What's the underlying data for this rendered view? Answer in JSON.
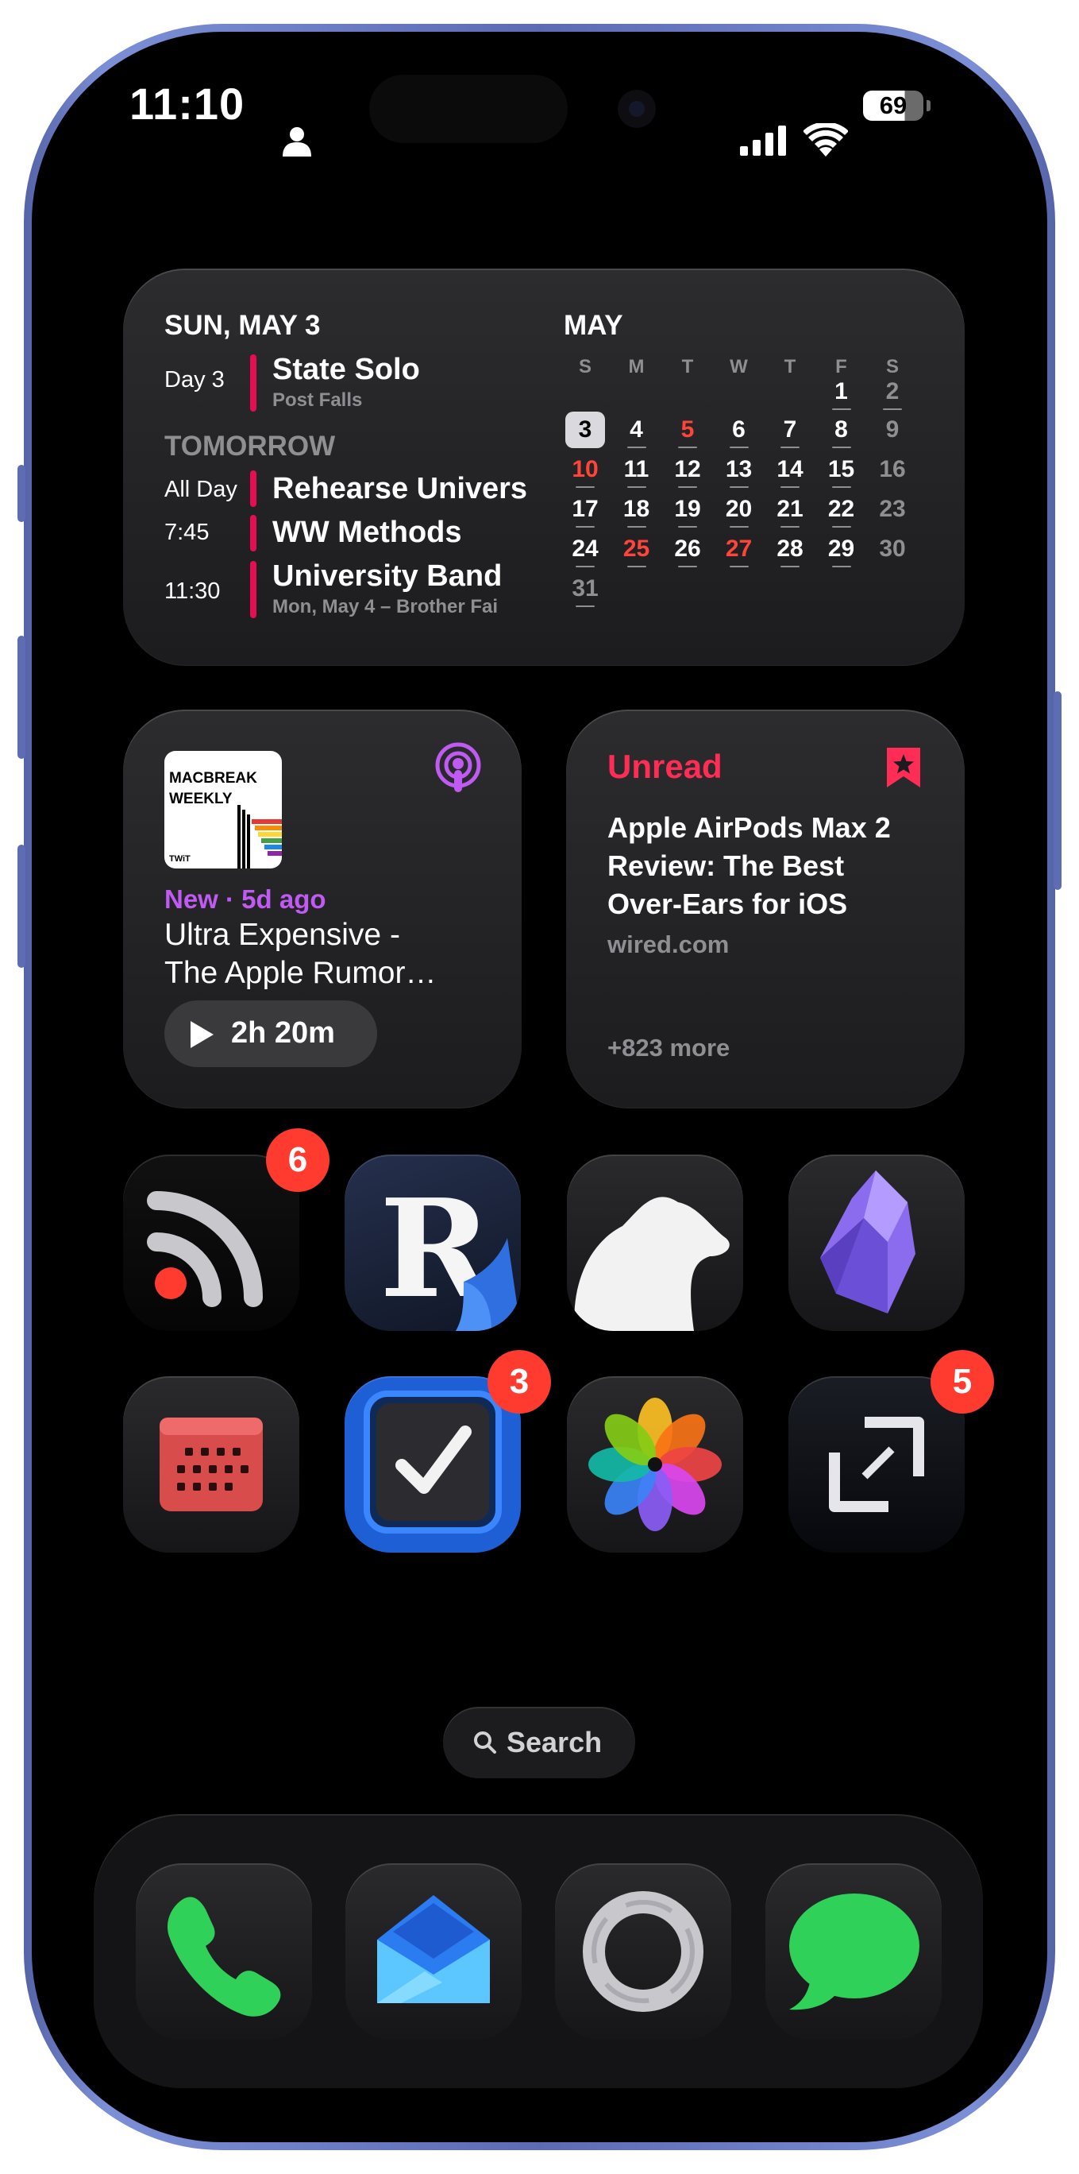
{
  "status_bar": {
    "time": "11:10",
    "battery": "69",
    "person_icon": "person-icon",
    "signal_icon": "cellular-signal-icon",
    "wifi_icon": "wifi-icon"
  },
  "calendar_widget": {
    "today_header": "SUN, MAY 3",
    "today_events": [
      {
        "time": "Day 3",
        "title": "State Solo",
        "subtitle": "Post Falls"
      }
    ],
    "tomorrow_header": "TOMORROW",
    "tomorrow_events": [
      {
        "time": "All Day",
        "title": "Rehearse Universi",
        "subtitle": ""
      },
      {
        "time": "7:45",
        "title": "WW Methods",
        "subtitle": ""
      },
      {
        "time": "11:30",
        "title": "University Band",
        "subtitle": "Mon, May 4 – Brother Fai"
      }
    ],
    "month": "MAY",
    "weekdays": [
      "S",
      "M",
      "T",
      "W",
      "T",
      "F",
      "S"
    ],
    "weeks": [
      [
        "",
        "",
        "",
        "",
        "",
        "1",
        "2"
      ],
      [
        "3",
        "4",
        "5",
        "6",
        "7",
        "8",
        "9"
      ],
      [
        "10",
        "11",
        "12",
        "13",
        "14",
        "15",
        "16"
      ],
      [
        "17",
        "18",
        "19",
        "20",
        "21",
        "22",
        "23"
      ],
      [
        "24",
        "25",
        "26",
        "27",
        "28",
        "29",
        "30"
      ],
      [
        "31",
        "",
        "",
        "",
        "",
        "",
        ""
      ]
    ],
    "today": "3",
    "red_days": [
      "5",
      "10",
      "25",
      "27"
    ],
    "accent_color": "#e60e52"
  },
  "podcast_widget": {
    "artwork_title": "MACBREAK WEEKLY",
    "artwork_brand": "TWiT",
    "status": "New · 5d ago",
    "episode_title_line1": "Ultra Expensive -",
    "episode_title_line2": "The Apple Rumor…",
    "duration": "2h 20m",
    "icon": "podcasts-icon",
    "accent_color": "#bf5af2"
  },
  "reader_widget": {
    "heading": "Unread",
    "article_line1": "Apple AirPods Max 2",
    "article_line2": "Review: The Best",
    "article_line3": "Over-Ears for iOS",
    "source": "wired.com",
    "more": "+823 more",
    "icon": "bookmark-star-icon",
    "accent_color": "#ff2d55"
  },
  "apps": {
    "row1": [
      {
        "name": "rss-reader-app",
        "badge": "6"
      },
      {
        "name": "reeder-app",
        "badge": ""
      },
      {
        "name": "bear-app",
        "badge": ""
      },
      {
        "name": "obsidian-app",
        "badge": ""
      }
    ],
    "row2": [
      {
        "name": "calendar-app",
        "badge": ""
      },
      {
        "name": "tasks-app",
        "badge": "3"
      },
      {
        "name": "photos-app",
        "badge": ""
      },
      {
        "name": "resize-app",
        "badge": "5"
      }
    ]
  },
  "search": {
    "label": "Search"
  },
  "dock": [
    "phone-app",
    "spark-mail-app",
    "beeper-app",
    "messages-app"
  ]
}
